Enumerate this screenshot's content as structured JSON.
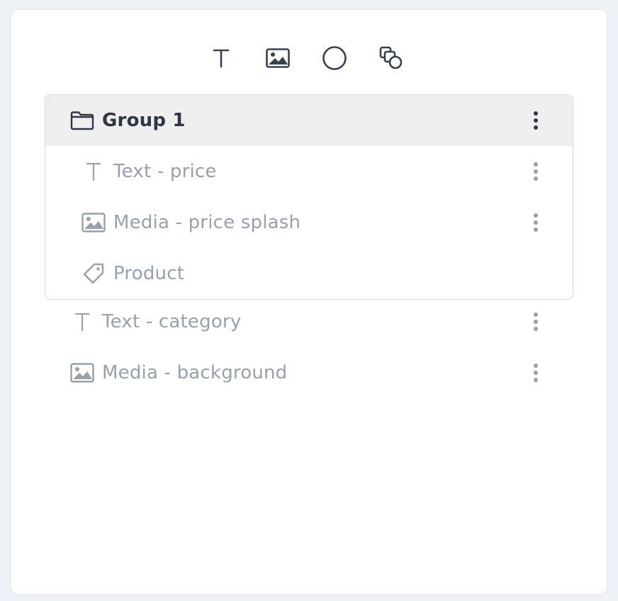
{
  "toolbar": {
    "tools": [
      {
        "icon": "text-icon",
        "name": "text"
      },
      {
        "icon": "image-icon",
        "name": "media"
      },
      {
        "icon": "circle-icon",
        "name": "shape"
      },
      {
        "icon": "group-icon",
        "name": "group"
      }
    ]
  },
  "layers": {
    "group": {
      "label": "Group 1",
      "icon": "folder-icon",
      "children": [
        {
          "label": "Text - price",
          "icon": "text-icon",
          "has_menu": true
        },
        {
          "label": "Media - price splash",
          "icon": "image-icon",
          "has_menu": true
        },
        {
          "label": "Product",
          "icon": "tag-icon",
          "has_menu": false
        }
      ]
    },
    "items": [
      {
        "label": "Text - category",
        "icon": "text-icon",
        "has_menu": true
      },
      {
        "label": "Media - background",
        "icon": "image-icon",
        "has_menu": true
      }
    ]
  },
  "colors": {
    "background": "#eef1f6",
    "panel": "#ffffff",
    "group_header": "#efefef",
    "active_text": "#2e3644",
    "muted_text": "#9aa0a9"
  }
}
